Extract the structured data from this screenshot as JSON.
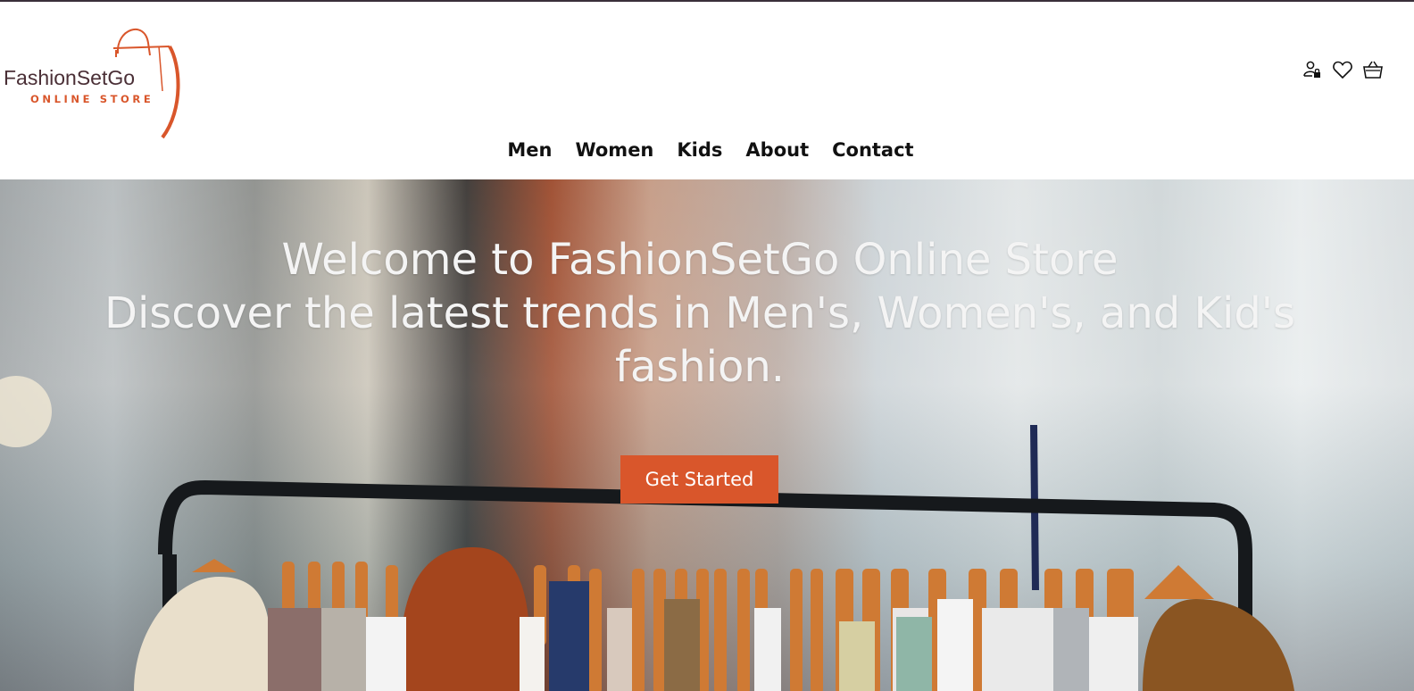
{
  "brand": {
    "name": "FashionSetGo",
    "tagline": "ONLINE STORE",
    "accent_color": "#d9562b",
    "name_color": "#4a2f36"
  },
  "header_icons": [
    "user-lock-icon",
    "heart-icon",
    "basket-icon"
  ],
  "nav": {
    "items": [
      {
        "label": "Men"
      },
      {
        "label": "Women"
      },
      {
        "label": "Kids"
      },
      {
        "label": "About"
      },
      {
        "label": "Contact"
      }
    ]
  },
  "hero": {
    "line1": "Welcome to FashionSetGo Online Store",
    "line2": "Discover the latest trends in Men's, Women's, and Kid's",
    "line3": "fashion.",
    "cta_label": "Get Started",
    "cta_color": "#d9562b"
  }
}
